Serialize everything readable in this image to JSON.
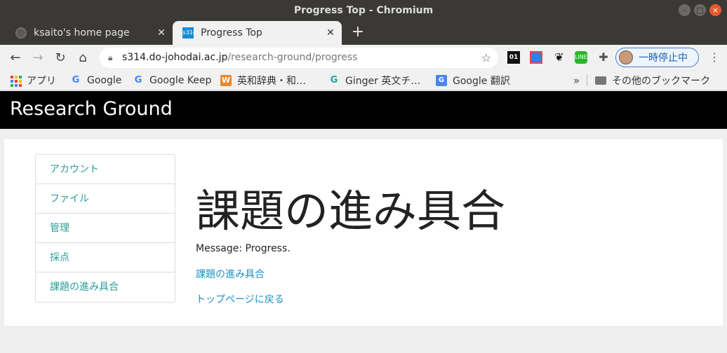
{
  "window": {
    "title": "Progress Top - Chromium"
  },
  "tabs": [
    {
      "label": "ksaito's home page",
      "active": false
    },
    {
      "label": "Progress Top",
      "active": true
    }
  ],
  "toolbar": {
    "url_host": "s314.do-johodai.ac.jp",
    "url_path": "/research-ground/progress",
    "profile_label": "一時停止中",
    "extensions": [
      "01-icon",
      "image-icon",
      "gnome-foot-icon",
      "line-icon",
      "puzzle-icon"
    ]
  },
  "bookmarks": {
    "items": [
      {
        "label": "アプリ",
        "icon": "apps-icon"
      },
      {
        "label": "Google",
        "icon": "google-icon"
      },
      {
        "label": "Google Keep",
        "icon": "google-icon"
      },
      {
        "label": "英和辞典・和…",
        "icon": "weblio-icon"
      },
      {
        "label": "Ginger 英文チ…",
        "icon": "ginger-icon"
      },
      {
        "label": "Google 翻訳",
        "icon": "google-translate-icon"
      }
    ],
    "other_label": "その他のブックマーク"
  },
  "site": {
    "brand": "Research Ground"
  },
  "sidebar": {
    "items": [
      {
        "label": "アカウント"
      },
      {
        "label": "ファイル"
      },
      {
        "label": "管理"
      },
      {
        "label": "採点"
      },
      {
        "label": "課題の進み具合"
      }
    ]
  },
  "main": {
    "heading": "課題の進み具合",
    "message": "Message: Progress.",
    "link_progress": "課題の進み具合",
    "link_top": "トップページに戻る"
  },
  "colors": {
    "accent_link": "#1f8fc7",
    "sidebar_link": "#2a9d97",
    "header_bg": "#000000",
    "profile_border": "#3a7fd1"
  }
}
